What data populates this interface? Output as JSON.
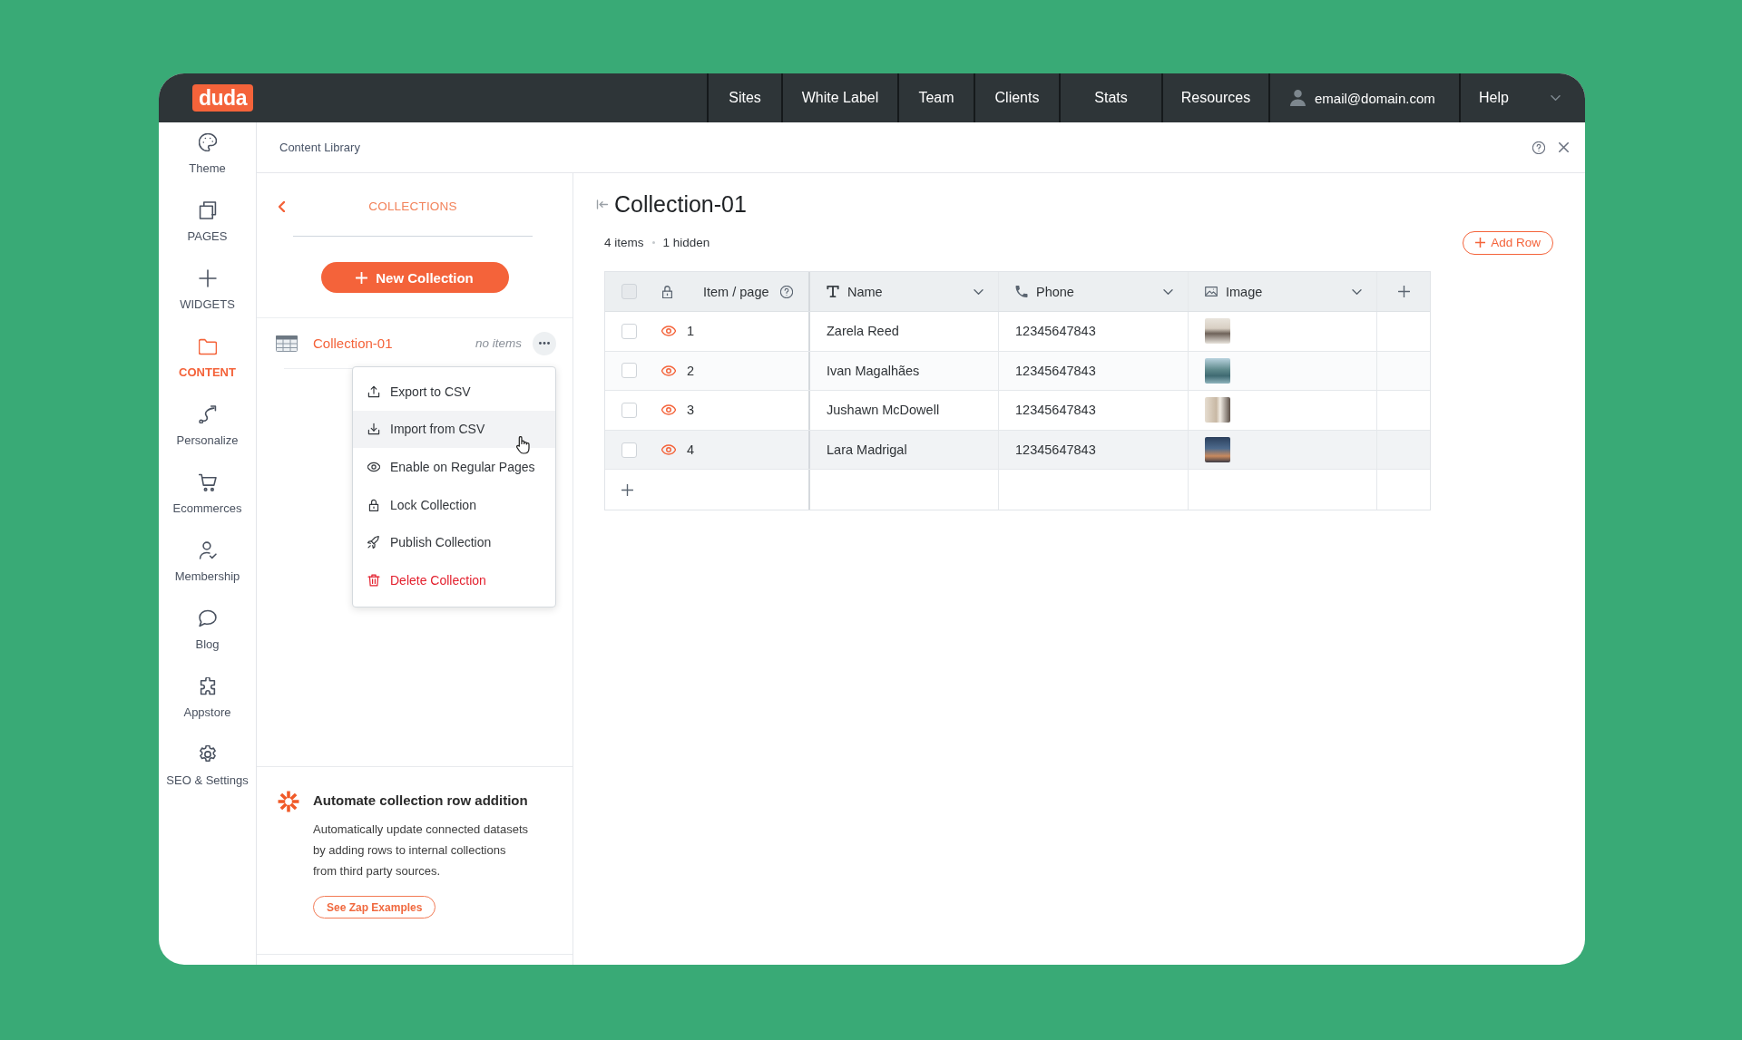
{
  "topbar": {
    "logo": "duda",
    "nav": [
      {
        "label": "Sites"
      },
      {
        "label": "White Label"
      },
      {
        "label": "Team"
      },
      {
        "label": "Clients"
      },
      {
        "label": "Stats"
      },
      {
        "label": "Resources"
      }
    ],
    "account": {
      "email": "email@domain.com"
    },
    "help": {
      "label": "Help"
    }
  },
  "sidebar": {
    "items": [
      {
        "label": "Theme",
        "selected": false
      },
      {
        "label": "PAGES",
        "selected": false
      },
      {
        "label": "WIDGETS",
        "selected": false
      },
      {
        "label": "CONTENT",
        "selected": true
      },
      {
        "label": "Personalize",
        "selected": false
      },
      {
        "label": "Ecommerces",
        "selected": false
      },
      {
        "label": "Membership",
        "selected": false
      },
      {
        "label": "Blog",
        "selected": false
      },
      {
        "label": "Appstore",
        "selected": false
      },
      {
        "label": "SEO & Settings",
        "selected": false
      }
    ]
  },
  "content_library": {
    "title": "Content Library"
  },
  "collections_panel": {
    "heading": "COLLECTIONS",
    "new_button": "New Collection",
    "collections": [
      {
        "name": "Collection-01",
        "count": "no items",
        "selected": true
      }
    ],
    "menu": [
      {
        "label": "Export to CSV",
        "kind": "action",
        "highlighted": false
      },
      {
        "label": "Import from CSV",
        "kind": "action",
        "highlighted": true
      },
      {
        "label": "Enable on Regular Pages",
        "kind": "action",
        "highlighted": false
      },
      {
        "label": "Lock Collection",
        "kind": "action",
        "highlighted": false
      },
      {
        "label": "Publish Collection",
        "kind": "action",
        "highlighted": false
      },
      {
        "label": "Delete Collection",
        "kind": "danger",
        "highlighted": false
      }
    ]
  },
  "promo": {
    "title": "Automate collection row addition",
    "text": "Automatically update connected datasets by adding rows to internal collections from third party sources.",
    "button": "See Zap Examples"
  },
  "main": {
    "title": "Collection-01",
    "item_count": "4 items",
    "hidden_count": "1 hidden",
    "add_row": "Add Row",
    "table": {
      "select_all": {
        "checked": false
      },
      "columns": [
        {
          "label": "Item / page"
        },
        {
          "label": "Name"
        },
        {
          "label": "Phone"
        },
        {
          "label": "Image"
        }
      ],
      "rows": [
        {
          "number": "1",
          "name": "Zarela Reed",
          "phone": "12345647843",
          "checked": false,
          "visible": true,
          "highlighted": false
        },
        {
          "number": "2",
          "name": "Ivan Magalhães",
          "phone": "12345647843",
          "checked": false,
          "visible": true,
          "highlighted": false
        },
        {
          "number": "3",
          "name": "Jushawn McDowell",
          "phone": "12345647843",
          "checked": false,
          "visible": true,
          "highlighted": false
        },
        {
          "number": "4",
          "name": "Lara Madrigal",
          "phone": "12345647843",
          "checked": false,
          "visible": true,
          "highlighted": true
        }
      ]
    }
  }
}
